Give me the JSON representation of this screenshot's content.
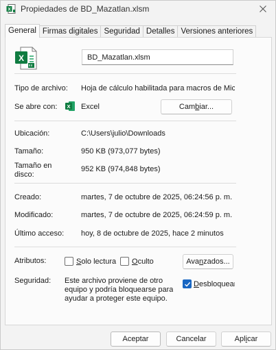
{
  "window": {
    "title": "Propiedades de BD_Mazatlan.xlsm"
  },
  "tabs": [
    {
      "label": "General",
      "active": true
    },
    {
      "label": "Firmas digitales"
    },
    {
      "label": "Seguridad"
    },
    {
      "label": "Detalles"
    },
    {
      "label": "Versiones anteriores"
    }
  ],
  "file": {
    "name": "BD_Mazatlan.xlsm",
    "icon": "excel-macro-file-icon"
  },
  "type": {
    "label": "Tipo de archivo:",
    "value": "Hoja de cálculo habilitada para macros de Micro"
  },
  "opens_with": {
    "label": "Se abre con:",
    "app": "Excel",
    "app_icon": "excel-icon",
    "change_button_prefix": "Cam",
    "change_button_mnemonic": "b",
    "change_button_suffix": "iar..."
  },
  "location": {
    "label": "Ubicación:",
    "value": "C:\\Users\\julio\\Downloads"
  },
  "size": {
    "label": "Tamaño:",
    "value": "950 KB (973,077 bytes)"
  },
  "size_on_disk": {
    "label_line1": "Tamaño en",
    "label_line2": "disco:",
    "value": "952 KB (974,848 bytes)"
  },
  "created": {
    "label": "Creado:",
    "value": "martes, 7 de octubre de 2025, 06:24:56 p. m."
  },
  "modified": {
    "label": "Modificado:",
    "value": "martes, 7 de octubre de 2025, 06:24:59 p. m."
  },
  "accessed": {
    "label": "Último acceso:",
    "value": "hoy, 8 de octubre de 2025, hace 2 minutos"
  },
  "attributes": {
    "label": "Atributos:",
    "readonly_mnemonic": "S",
    "readonly_rest": "olo lectura",
    "readonly_checked": false,
    "hidden_mnemonic": "O",
    "hidden_rest": "culto",
    "hidden_checked": false,
    "advanced_prefix": "Ava",
    "advanced_mnemonic": "n",
    "advanced_suffix": "zados..."
  },
  "security": {
    "label": "Seguridad:",
    "message_line1": "Este archivo proviene de otro",
    "message_line2": "equipo y podría bloquearse para",
    "message_line3": "ayudar a proteger este equipo.",
    "unblock_mnemonic": "D",
    "unblock_rest": "esbloquear",
    "unblock_checked": true
  },
  "footer": {
    "accept": "Aceptar",
    "cancel": "Cancelar",
    "apply_prefix": "Apl",
    "apply_mnemonic": "i",
    "apply_suffix": "car"
  },
  "colors": {
    "excel_green": "#107c41",
    "accent_blue": "#1866c2"
  }
}
